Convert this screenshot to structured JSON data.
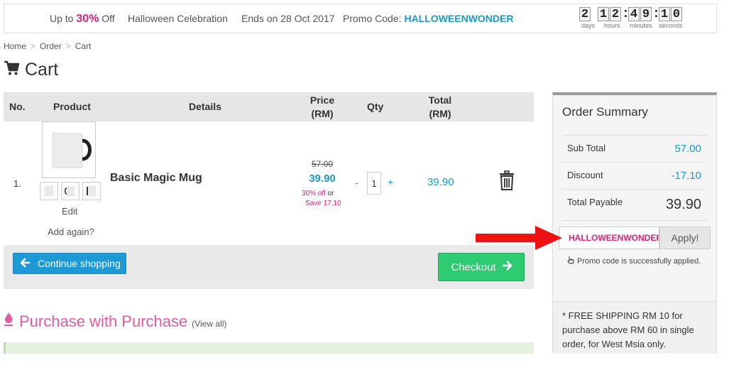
{
  "banner": {
    "up_to_prefix": "Up to",
    "discount": "30%",
    "off": "Off",
    "event": "Halloween Celebration",
    "ends": "Ends on 28 Oct 2017",
    "promo_label": "Promo Code:",
    "promo_code": "HALLOWEENWONDER",
    "countdown": {
      "days": "2",
      "hours": "12",
      "minutes": "49",
      "seconds": "10",
      "label_days": "days",
      "label_hours": "hours",
      "label_minutes": "minutes",
      "label_seconds": "seconds"
    }
  },
  "breadcrumb": [
    "Home",
    "Order",
    "Cart"
  ],
  "breadcrumb_separator": ">",
  "page_title": "Cart",
  "table": {
    "headers": {
      "no": "No.",
      "product": "Product",
      "details": "Details",
      "price_1": "Price",
      "price_2": "(RM)",
      "qty": "Qty",
      "total_1": "Total",
      "total_2": "(RM)"
    },
    "row": {
      "no": "1.",
      "edit": "Edit",
      "add_again": "Add again?",
      "name": "Basic Magic Mug",
      "price_old": "57.00",
      "price_new": "39.90",
      "off_text": "30% off",
      "or_text": "or",
      "save_text": "Save 17.10",
      "qty_minus": "-",
      "qty": "1",
      "qty_plus": "+",
      "total": "39.90"
    }
  },
  "buttons": {
    "continue": "Continue shopping",
    "checkout": "Checkout"
  },
  "pwp": {
    "title": "Purchase with Purchase",
    "view_all": "(View all)"
  },
  "summary": {
    "title": "Order Summary",
    "subtotal_label": "Sub Total",
    "subtotal": "57.00",
    "discount_label": "Discount",
    "discount": "-17.10",
    "payable_label": "Total Payable",
    "payable": "39.90",
    "promo_input_value": "HALLOWEENWONDER",
    "apply_label": "Apply!",
    "promo_status": "Promo code is successfully applied.",
    "shipping_note": "* FREE SHIPPING RM 10 for purchase above RM 60 in single order, for West Msia only."
  },
  "colors": {
    "accent_blue": "#1d9ac2",
    "accent_pink": "#d6237e",
    "checkout_green": "#2ecc71",
    "continue_blue": "#1d9ad6",
    "annotation_red": "#ee1111"
  },
  "icons": [
    "cart-icon",
    "trash-icon",
    "arrow-left-icon",
    "arrow-right-icon",
    "flame-icon",
    "pointer-hand-icon"
  ]
}
